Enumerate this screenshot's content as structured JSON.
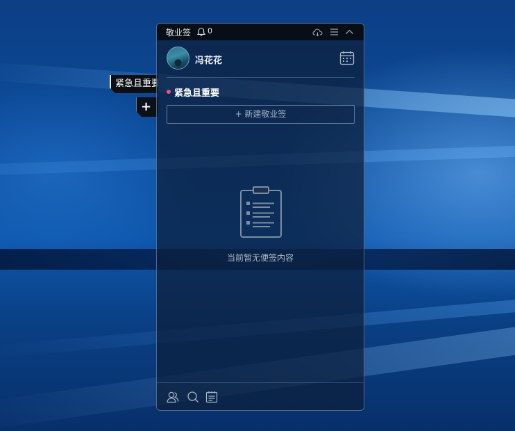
{
  "mini_tag": {
    "label": "紧急且重要",
    "add_label": "+"
  },
  "titlebar": {
    "app_title": "敬业签",
    "notification_count": "0",
    "icons": [
      "cloud-sync-icon",
      "menu-icon",
      "collapse-icon"
    ]
  },
  "user": {
    "name": "冯花花",
    "avatar": "avatar"
  },
  "category": {
    "title": "紧急且重要",
    "dot_color": "#e8547a"
  },
  "new_note_button": "+ 新建敬业签",
  "empty_state": {
    "icon": "clipboard-icon",
    "text": "当前暂无便签内容"
  },
  "footer": {
    "icons": [
      "contacts-icon",
      "search-icon",
      "notes-list-icon"
    ]
  }
}
